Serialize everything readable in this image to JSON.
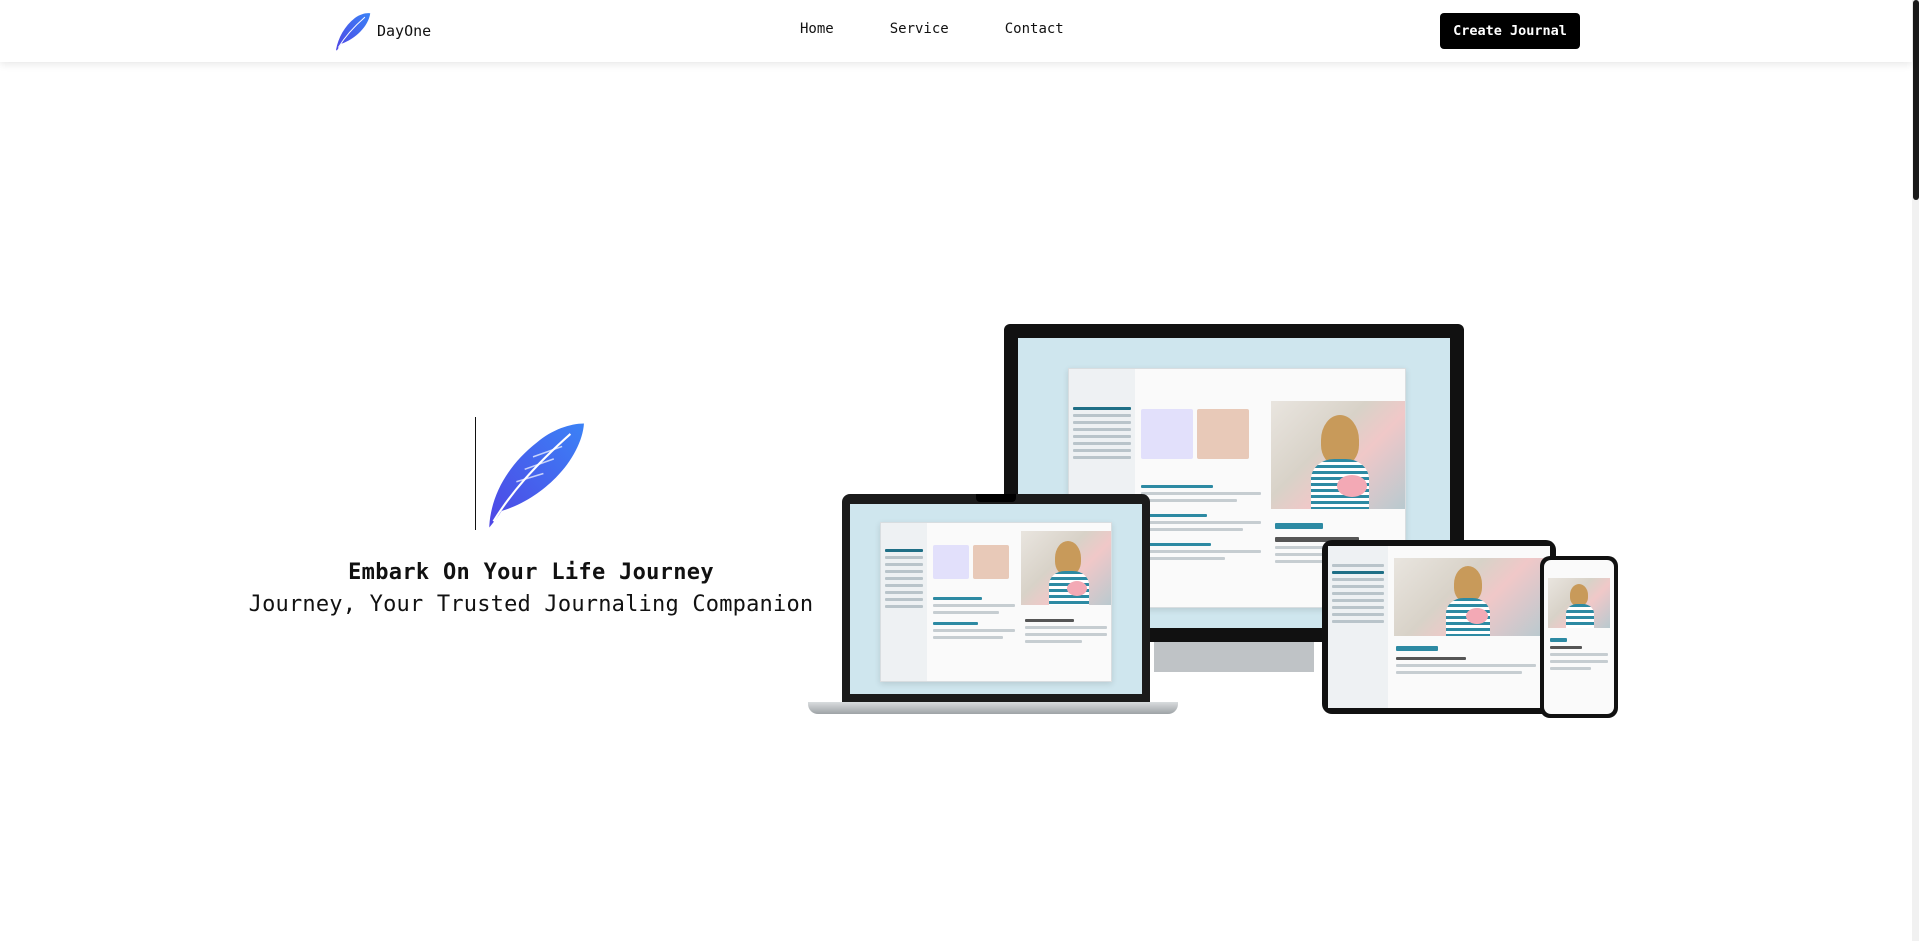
{
  "header": {
    "brand_name": "DayOne",
    "nav": {
      "home": "Home",
      "service": "Service",
      "contact": "Contact"
    },
    "cta_label": "Create Journal"
  },
  "hero": {
    "title": "Embark On Your Life Journey",
    "subtitle": "Journey, Your Trusted Journaling Companion"
  },
  "colors": {
    "logo_gradient_start": "#3b82f6",
    "logo_gradient_end": "#4f46e5",
    "cta_background": "#000000",
    "screen_background": "#cfe6ee"
  },
  "icons": {
    "brand": "feather-icon",
    "hero": "feather-icon"
  }
}
